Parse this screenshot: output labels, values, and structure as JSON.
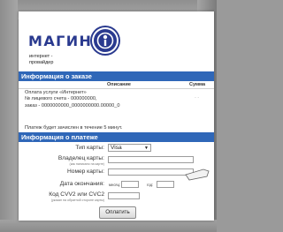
{
  "logo": {
    "word": "МАГИНФ",
    "subtitle_line1": "интернет -",
    "subtitle_line2": "провайдер"
  },
  "order": {
    "header": "Информация о заказе",
    "col_description": "Описание",
    "col_sum": "Сумма",
    "line1": "Оплата услуги «Интернет»",
    "line2": "№ лицевого счета - 000000000,",
    "line3": "заказ - 0000000000_0000000000.00000_0",
    "sum": "- -",
    "note": "Платеж будет зачислен в течение 5 минут."
  },
  "payment": {
    "header": "Информация о платеже",
    "card_type_label": "Тип карты:",
    "card_type_value": "Visa",
    "holder_label": "Владелец карты:",
    "holder_hint": "(как написано на карте)",
    "number_label": "Номер карты:",
    "expiry_label": "Дата окончания:",
    "month_label": "месяц:",
    "year_label": "год:",
    "cvv_label": "Код CVV2 или CVC2",
    "cvv_hint": "(указан на обратной стороне карты)",
    "pay_button": "Оплатить"
  },
  "colors": {
    "brand": "#2a3a8f",
    "header_bg": "#2f67b8"
  }
}
